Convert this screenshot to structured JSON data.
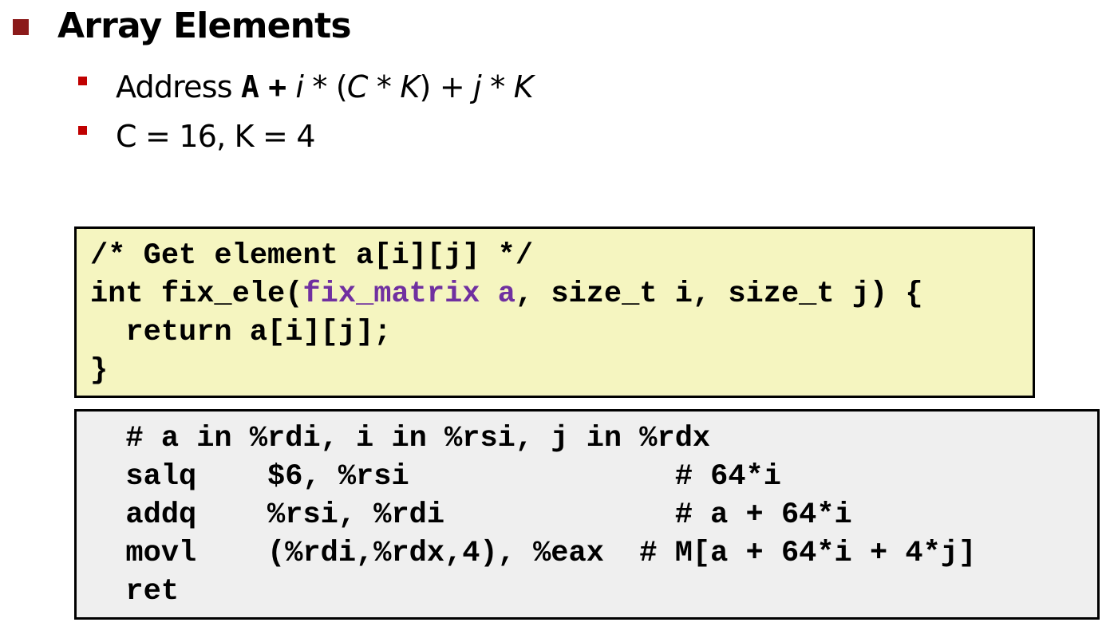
{
  "heading": {
    "text": "Array Elements"
  },
  "bullets": {
    "address": {
      "label": "Address",
      "base": "A",
      "plus": "+",
      "i": "i",
      "times1": " * (",
      "C": "C",
      "times2": " * ",
      "K1": "K",
      "rest": ") + ",
      "j": "j",
      "times3": " * ",
      "K2": "K"
    },
    "constants": "C = 16, K = 4"
  },
  "c_code": {
    "line1": "/* Get element a[i][j] */",
    "line2_pre": "int fix_ele(",
    "line2_type": "fix_matrix a",
    "line2_post": ", size_t i, size_t j) {",
    "line3": "  return a[i][j];",
    "line4": "}"
  },
  "asm_code": {
    "lines": [
      "  # a in %rdi, i in %rsi, j in %rdx",
      "  salq    $6, %rsi               # 64*i",
      "  addq    %rsi, %rdi             # a + 64*i",
      "  movl    (%rdi,%rdx,4), %eax  # M[a + 64*i + 4*j]",
      "  ret"
    ]
  },
  "colors": {
    "heading_bullet": "#8b1a1a",
    "sub_bullet": "#c00000",
    "c_box_background": "#f5f5c0",
    "asm_box_background": "#efefef",
    "highlight_type": "#7030a0"
  }
}
